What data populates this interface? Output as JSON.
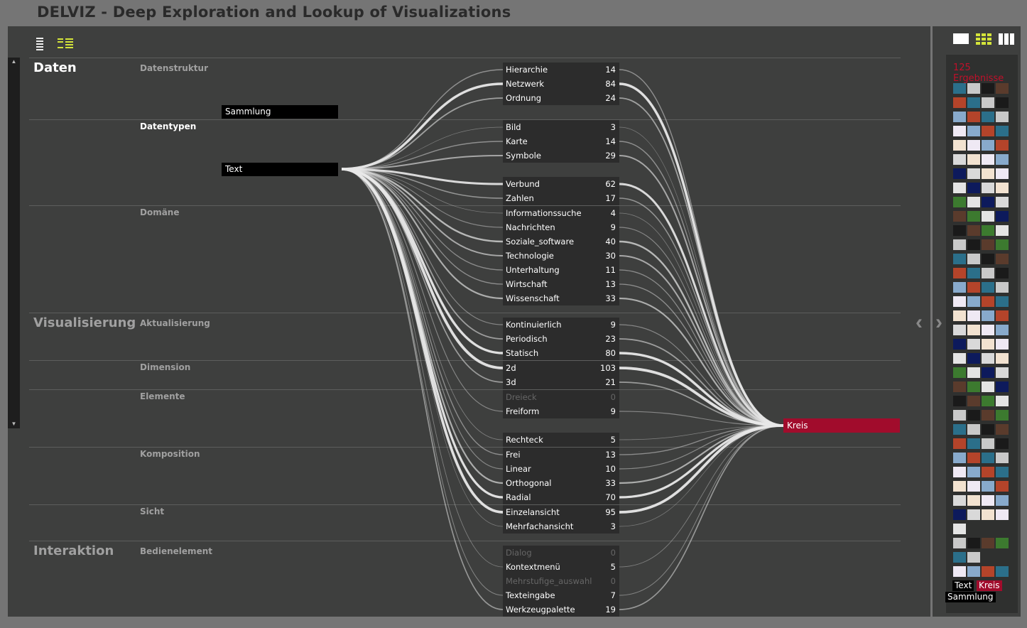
{
  "app_title": "DELVIZ - Deep Exploration and Lookup of Visualizations",
  "groups": {
    "daten": "Daten",
    "visualisierung": "Visualisierung",
    "interaktion": "Interaktion"
  },
  "categories": {
    "datenstruktur": "Datenstruktur",
    "datentypen": "Datentypen",
    "domaene": "Domäne",
    "aktualisierung": "Aktualisierung",
    "dimension": "Dimension",
    "elemente": "Elemente",
    "komposition": "Komposition",
    "sicht": "Sicht",
    "bedienelement": "Bedienelement"
  },
  "selected": {
    "sammlung": "Sammlung",
    "text": "Text",
    "kreis": "Kreis"
  },
  "terms": [
    {
      "label": "Hierarchie",
      "count": "14",
      "dim": false
    },
    {
      "label": "Netzwerk",
      "count": "84",
      "dim": false
    },
    {
      "label": "Ordnung",
      "count": "24",
      "dim": false
    },
    {
      "label": "Bild",
      "count": "3",
      "dim": false
    },
    {
      "label": "Karte",
      "count": "14",
      "dim": false
    },
    {
      "label": "Symbole",
      "count": "29",
      "dim": false
    },
    {
      "label": "Verbund",
      "count": "62",
      "dim": false
    },
    {
      "label": "Zahlen",
      "count": "17",
      "dim": false
    },
    {
      "label": "Informationssuche",
      "count": "4",
      "dim": false
    },
    {
      "label": "Nachrichten",
      "count": "9",
      "dim": false
    },
    {
      "label": "Soziale_software",
      "count": "40",
      "dim": false
    },
    {
      "label": "Technologie",
      "count": "30",
      "dim": false
    },
    {
      "label": "Unterhaltung",
      "count": "11",
      "dim": false
    },
    {
      "label": "Wirtschaft",
      "count": "13",
      "dim": false
    },
    {
      "label": "Wissenschaft",
      "count": "33",
      "dim": false
    },
    {
      "label": "Kontinuierlich",
      "count": "9",
      "dim": false
    },
    {
      "label": "Periodisch",
      "count": "23",
      "dim": false
    },
    {
      "label": "Statisch",
      "count": "80",
      "dim": false
    },
    {
      "label": "2d",
      "count": "103",
      "dim": false
    },
    {
      "label": "3d",
      "count": "21",
      "dim": false
    },
    {
      "label": "Dreieck",
      "count": "0",
      "dim": true
    },
    {
      "label": "Freiform",
      "count": "9",
      "dim": false
    },
    {
      "label": "Rechteck",
      "count": "5",
      "dim": false
    },
    {
      "label": "Frei",
      "count": "13",
      "dim": false
    },
    {
      "label": "Linear",
      "count": "10",
      "dim": false
    },
    {
      "label": "Orthogonal",
      "count": "33",
      "dim": false
    },
    {
      "label": "Radial",
      "count": "70",
      "dim": false
    },
    {
      "label": "Einzelansicht",
      "count": "95",
      "dim": false
    },
    {
      "label": "Mehrfachansicht",
      "count": "3",
      "dim": false
    },
    {
      "label": "Dialog",
      "count": "0",
      "dim": true
    },
    {
      "label": "Kontextmenü",
      "count": "5",
      "dim": false
    },
    {
      "label": "Mehrstufige_auswahl",
      "count": "0",
      "dim": true
    },
    {
      "label": "Texteingabe",
      "count": "7",
      "dim": false
    },
    {
      "label": "Werkzeugpalette",
      "count": "19",
      "dim": false
    }
  ],
  "sidebar": {
    "results_label": "125 Ergebnisse",
    "active_tags": [
      "Text",
      "Kreis",
      "Sammlung"
    ]
  },
  "colors": {
    "accent": "#a10c2c",
    "results_text": "#c0102a",
    "view_icon_active": "#d4e43a"
  },
  "icons": [
    "list-view-icon",
    "tree-view-icon",
    "single-view-icon",
    "grid-view-icon",
    "column-view-icon",
    "chevron-left-icon",
    "chevron-right-icon"
  ]
}
